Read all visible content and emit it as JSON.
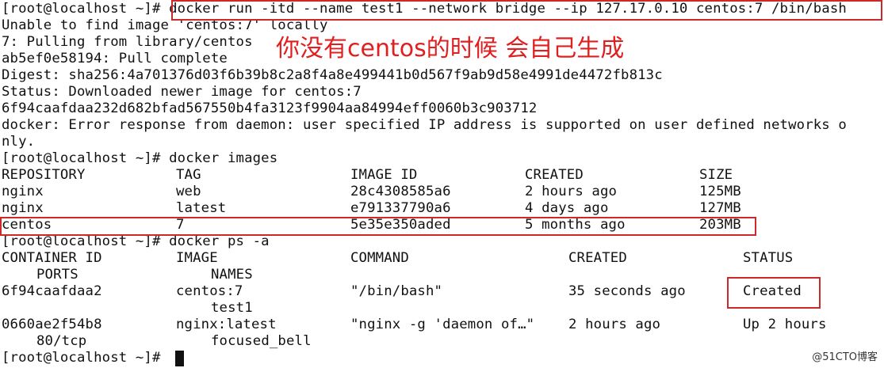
{
  "terminal": {
    "lines": [
      "[root@localhost ~]# docker run -itd --name test1 --network bridge --ip 127.17.0.10 centos:7 /bin/bash",
      "Unable to find image 'centos:7' locally",
      "7: Pulling from library/centos",
      "ab5ef0e58194: Pull complete",
      "Digest: sha256:4a701376d03f6b39b8c2a8f4a8e499441b0d567f9ab9d58e4991de4472fb813c",
      "Status: Downloaded newer image for centos:7",
      "6f94caafdaa232d682bfad567550b4fa3123f9904aa84994eff0060b3c903712",
      "docker: Error response from daemon: user specified IP address is supported on user defined networks o",
      "nly.",
      "[root@localhost ~]# docker images"
    ],
    "images_table": {
      "headers": [
        "REPOSITORY",
        "TAG",
        "IMAGE ID",
        "CREATED",
        "SIZE"
      ],
      "rows": [
        [
          "nginx",
          "web",
          "28c4308585a6",
          "2 hours ago",
          "125MB"
        ],
        [
          "nginx",
          "latest",
          "e791337790a6",
          "4 days ago",
          "127MB"
        ],
        [
          "centos",
          "7",
          "5e35e350aded",
          "5 months ago",
          "203MB"
        ]
      ]
    },
    "ps_prompt": "[root@localhost ~]# docker ps -a",
    "ps_table": {
      "headers": [
        "CONTAINER ID",
        "IMAGE",
        "COMMAND",
        "CREATED",
        "STATUS",
        "PORTS",
        "NAMES"
      ],
      "rows": [
        {
          "id": "6f94caafdaa2",
          "image": "centos:7",
          "command": "\"/bin/bash\"",
          "created": "35 seconds ago",
          "status": "Created",
          "ports": "",
          "names": "test1"
        },
        {
          "id": "0660ae2f54b8",
          "image": "nginx:latest",
          "command": "\"nginx -g 'daemon of…\"",
          "created": "2 hours ago",
          "status": "Up 2 hours",
          "ports": "80/tcp",
          "names": "focused_bell"
        }
      ]
    },
    "final_prompt": "[root@localhost ~]# "
  },
  "annotation": "你没有centos的时候 会自己生成",
  "watermark": "@51CTO博客",
  "colors": {
    "highlight_box": "#cc2a2a",
    "annotation_text": "#e02020",
    "background": "#ffffff",
    "text": "#111111"
  }
}
